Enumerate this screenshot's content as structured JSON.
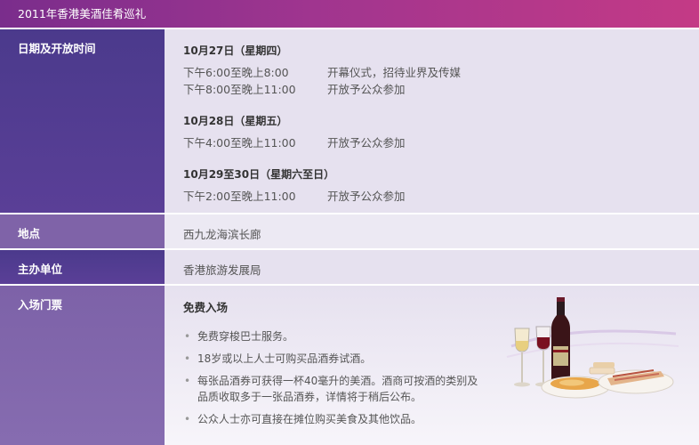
{
  "header": {
    "title": "2011年香港美酒佳肴巡礼"
  },
  "rows": {
    "dates": {
      "label": "日期及开放时间",
      "groups": [
        {
          "date": "10月27日（星期四）",
          "items": [
            {
              "time": "下午6:00至晚上8:00",
              "desc": "开幕仪式，招待业界及传媒"
            },
            {
              "time": "下午8:00至晚上11:00",
              "desc": "开放予公众参加"
            }
          ]
        },
        {
          "date": "10月28日（星期五）",
          "items": [
            {
              "time": "下午4:00至晚上11:00",
              "desc": "开放予公众参加"
            }
          ]
        },
        {
          "date": "10月29至30日（星期六至日）",
          "items": [
            {
              "time": "下午2:00至晚上11:00",
              "desc": "开放予公众参加"
            }
          ]
        }
      ]
    },
    "venue": {
      "label": "地点",
      "value": "西九龙海滨长廊"
    },
    "organizer": {
      "label": "主办单位",
      "value": "香港旅游发展局"
    },
    "admission": {
      "label": "入场门票",
      "title": "免费入场",
      "bullets": [
        "免费穿梭巴士服务。",
        "18岁或以上人士可购买品酒券试酒。",
        "每张品酒券可获得一杯40毫升的美酒。酒商可按酒的类别及品质收取多于一张品酒券，详情将于稍后公布。",
        "公众人士亦可直接在摊位购买美食及其他饮品。"
      ]
    }
  },
  "colors": {
    "header": "#a0358f",
    "label_dark": "#4b3a8c",
    "label_light": "#7f63a8",
    "content_bg": "#e6e1ef"
  }
}
